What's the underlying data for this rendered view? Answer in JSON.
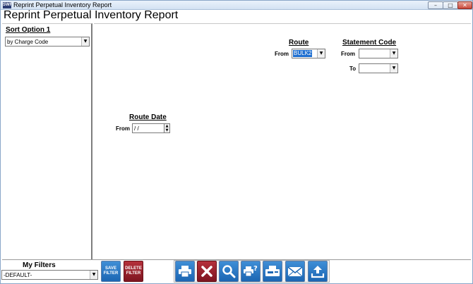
{
  "window": {
    "title": "Reprint Perpetual Inventory Report",
    "app_icon_text": "SWF"
  },
  "report_title": "Reprint Perpetual Inventory Report",
  "sort": {
    "label": "Sort Option 1",
    "value": "by Charge Code"
  },
  "route": {
    "heading": "Route",
    "from_label": "From",
    "from_value": "BULK2"
  },
  "statement_code": {
    "heading": "Statement Code",
    "from_label": "From",
    "from_value": "",
    "to_label": "To",
    "to_value": ""
  },
  "route_date": {
    "heading": "Route Date",
    "from_label": "From",
    "from_value": " / /"
  },
  "filters": {
    "label": "My Filters",
    "value": "-DEFAULT-",
    "save_label_1": "SAVE",
    "save_label_2": "FILTER",
    "delete_label_1": "DELETE",
    "delete_label_2": "FILTER"
  },
  "toolbar": [
    "print-icon",
    "cancel-icon",
    "preview-icon",
    "print-setup-icon",
    "fax-icon",
    "email-icon",
    "export-icon"
  ],
  "colors": {
    "accent_blue": "#1b66b3",
    "accent_red": "#7e1520"
  }
}
